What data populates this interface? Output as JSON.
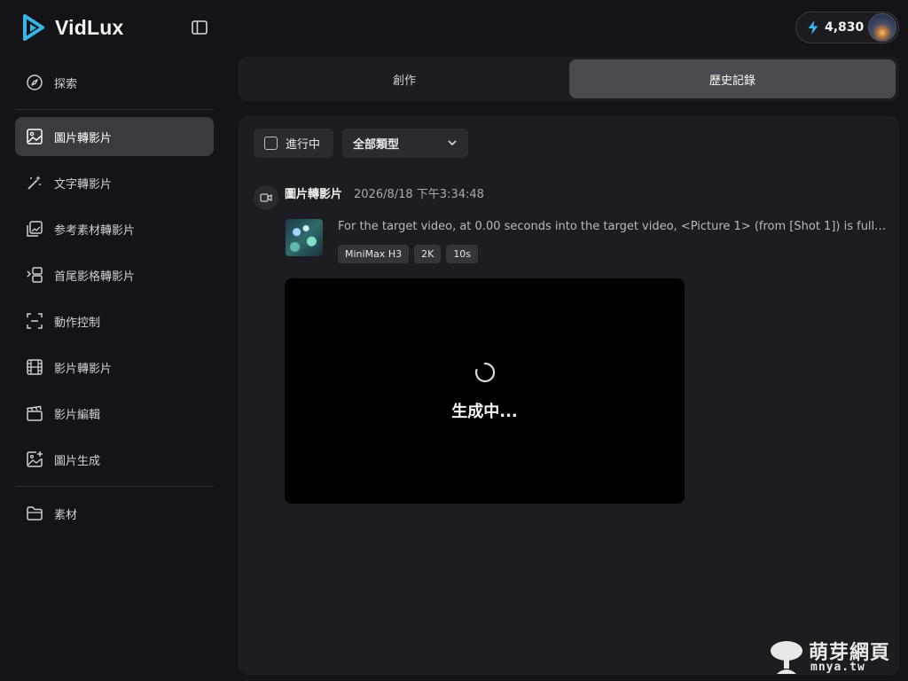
{
  "app": {
    "name": "VidLux",
    "accent": "#38b6e8"
  },
  "sidebar": {
    "items": [
      {
        "label": "探索",
        "icon": "compass-icon"
      },
      {
        "label": "圖片轉影片",
        "icon": "image-icon",
        "active": true
      },
      {
        "label": "文字轉影片",
        "icon": "magic-wand-icon"
      },
      {
        "label": "参考素材轉影片",
        "icon": "images-stack-icon"
      },
      {
        "label": "首尾影格轉影片",
        "icon": "frames-icon"
      },
      {
        "label": "動作控制",
        "icon": "scan-icon"
      },
      {
        "label": "影片轉影片",
        "icon": "film-icon"
      },
      {
        "label": "影片編輯",
        "icon": "clapperboard-icon"
      },
      {
        "label": "圖片生成",
        "icon": "image-plus-icon"
      },
      {
        "label": "素材",
        "icon": "folder-icon"
      }
    ]
  },
  "header": {
    "credits": "4,830"
  },
  "tabs": [
    {
      "label": "創作",
      "active": false
    },
    {
      "label": "歷史記錄",
      "active": true
    }
  ],
  "filters": {
    "in_progress_label": "進行中",
    "type_select_value": "全部類型"
  },
  "task": {
    "type": "圖片轉影片",
    "timestamp": "2026/8/18 下午3:34:48",
    "prompt": "For the target video, at 0.00 seconds into the target video, <Picture 1> (from [Shot 1]) is fully...",
    "tags": [
      "MiniMax H3",
      "2K",
      "10s"
    ],
    "status": "生成中..."
  },
  "watermark": {
    "title": "萌芽網頁",
    "sub": "mnya.tw"
  }
}
